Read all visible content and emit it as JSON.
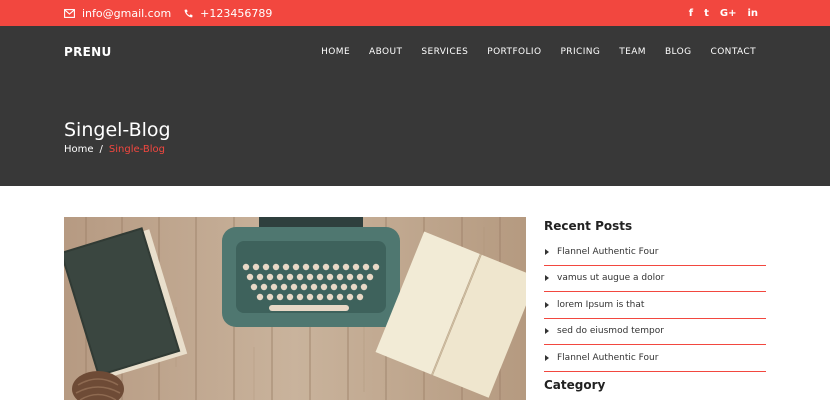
{
  "topbar": {
    "email": "info@gmail.com",
    "phone": "+123456789",
    "social": [
      {
        "icon": "facebook-icon",
        "glyph": "f"
      },
      {
        "icon": "twitter-icon",
        "glyph": "t"
      },
      {
        "icon": "google-plus-icon",
        "glyph": "G+"
      },
      {
        "icon": "linkedin-icon",
        "glyph": "in"
      }
    ],
    "color": "#f2473f"
  },
  "header": {
    "brand": "PRENU",
    "nav": [
      "HOME",
      "ABOUT",
      "SERVICES",
      "PORTFOLIO",
      "PRICING",
      "TEAM",
      "BLOG",
      "CONTACT"
    ],
    "page_title": "Singel-Blog",
    "breadcrumb": {
      "home": "Home",
      "separator": "/",
      "current": "Single-Blog"
    },
    "background": "#383838"
  },
  "sidebar": {
    "recent_title": "Recent Posts",
    "recent_posts": [
      "Flannel Authentic Four",
      "vamus ut augue a dolor",
      "lorem Ipsum is that",
      "sed do eiusmod tempor",
      "Flannel Authentic Four"
    ],
    "category_title": "Category"
  }
}
